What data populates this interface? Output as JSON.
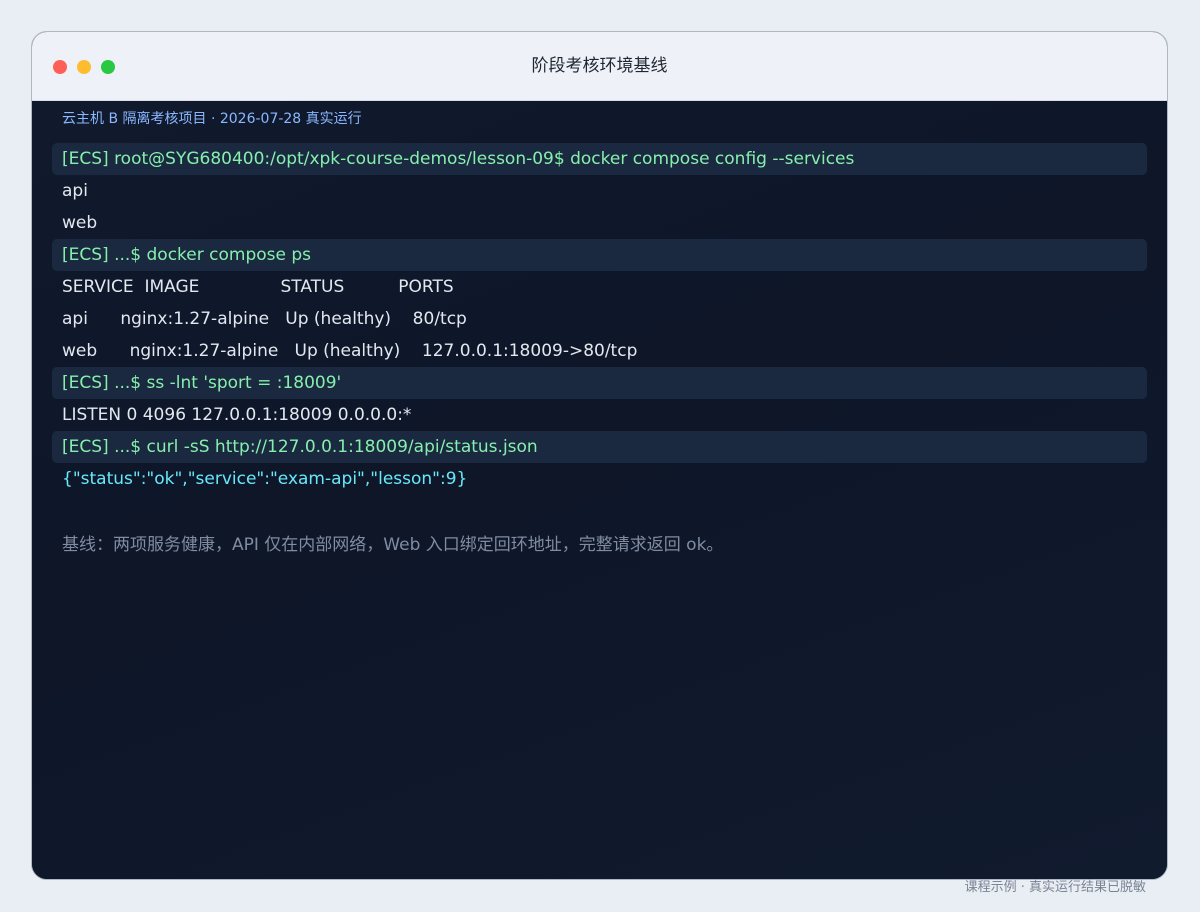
{
  "window": {
    "title": "阶段考核环境基线",
    "traffic_lights": {
      "close_color": "#ff5f57",
      "minimize_color": "#febc2e",
      "zoom_color": "#28c840"
    }
  },
  "terminal": {
    "caption": "云主机 B 隔离考核项目 · 2026-07-28 真实运行",
    "lines": [
      {
        "type": "cmd",
        "text": "[ECS] root@SYG680400:/opt/xpk-course-demos/lesson-09$ docker compose config --services"
      },
      {
        "type": "out",
        "text": "api"
      },
      {
        "type": "out",
        "text": "web"
      },
      {
        "type": "cmd",
        "text": "[ECS] ...$ docker compose ps"
      },
      {
        "type": "out",
        "text": "SERVICE  IMAGE               STATUS          PORTS"
      },
      {
        "type": "out",
        "text": "api      nginx:1.27-alpine   Up (healthy)    80/tcp"
      },
      {
        "type": "out",
        "text": "web      nginx:1.27-alpine   Up (healthy)    127.0.0.1:18009->80/tcp"
      },
      {
        "type": "cmd",
        "text": "[ECS] ...$ ss -lnt 'sport = :18009'"
      },
      {
        "type": "out",
        "text": "LISTEN 0 4096 127.0.0.1:18009 0.0.0.0:*"
      },
      {
        "type": "cmd",
        "text": "[ECS] ...$ curl -sS http://127.0.0.1:18009/api/status.json"
      },
      {
        "type": "json",
        "text": "{\"status\":\"ok\",\"service\":\"exam-api\",\"lesson\":9}"
      }
    ],
    "note": "基线：两项服务健康，API 仅在内部网络，Web 入口绑定回环地址，完整请求返回 ok。"
  },
  "footer": "课程示例 · 真实运行结果已脱敏"
}
